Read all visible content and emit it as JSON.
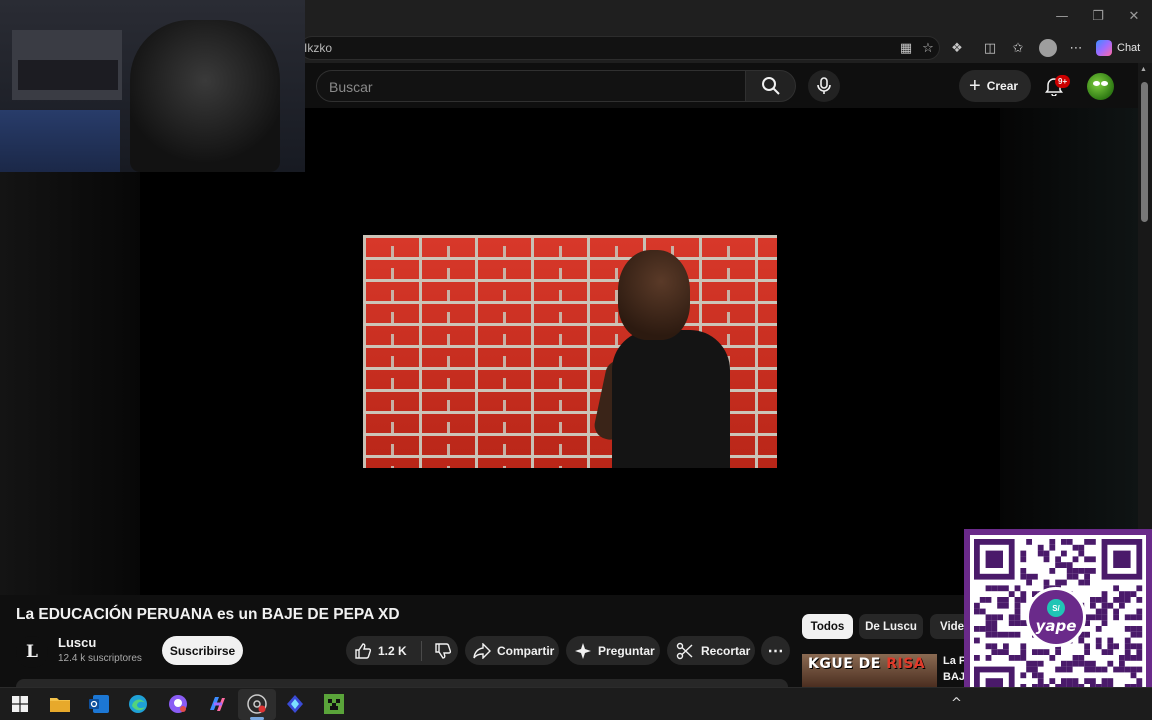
{
  "browser": {
    "url_fragment": "Ikzko",
    "chat_label": "Chat",
    "window_controls": [
      "minimize-icon",
      "restore-icon",
      "close-icon"
    ],
    "toolbar_icons": [
      "app-view-icon",
      "favorite-star-icon",
      "extensions-icon",
      "split-screen-icon",
      "favorites-icon",
      "profile-icon",
      "more-icon",
      "copilot-icon"
    ]
  },
  "header": {
    "search_placeholder": "Buscar",
    "create_label": "Crear",
    "notification_badge": "9+"
  },
  "video": {
    "title": "La EDUCACIÓN PERUANA es un BAJE DE PEPA XD",
    "channel_initial": "L",
    "channel_name": "Luscu",
    "subscribers": "12.4 k suscriptores",
    "subscribe_label": "Suscribirse",
    "likes": "1.2 K",
    "share_label": "Compartir",
    "ask_label": "Preguntar",
    "clip_label": "Recortar",
    "more_label": "⋯"
  },
  "chips": {
    "all": "Todos",
    "from_channel": "De Luscu",
    "videos": "Videos"
  },
  "recommendation": {
    "thumb_text_a": "KGUE DE ",
    "thumb_text_b": "RISA",
    "title_a": "La P",
    "title_b": "BAJ"
  },
  "qr": {
    "brand": "yape",
    "coin": "S/"
  },
  "colors": {
    "background": "#0f0f0f",
    "accent_red": "#cc0000",
    "yape_purple": "#6a2a8a",
    "yape_teal": "#20c5b5"
  },
  "taskbar": {
    "apps": [
      "windows-start-icon",
      "file-explorer-icon",
      "outlook-icon",
      "edge-icon",
      "messenger-icon",
      "copilot-icon",
      "obs-icon",
      "dev-tool-icon",
      "minecraft-icon"
    ],
    "tray_chevron": "^"
  }
}
